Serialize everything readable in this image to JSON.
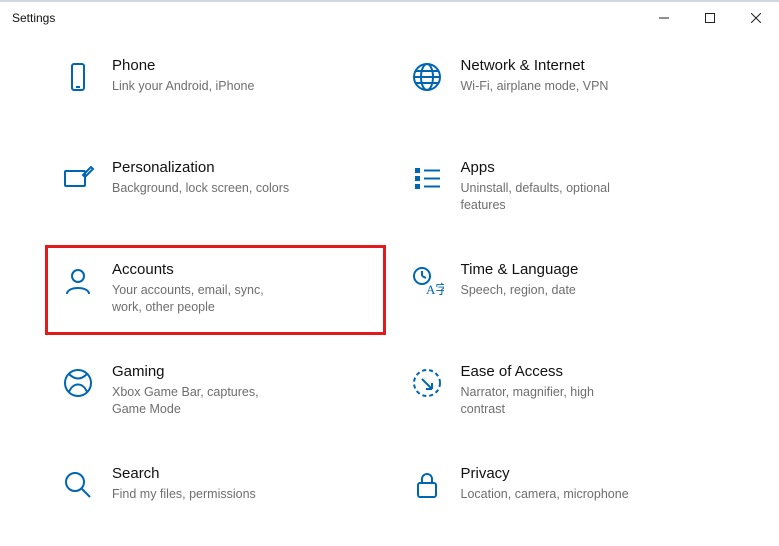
{
  "window": {
    "title": "Settings"
  },
  "highlightIndex": 4,
  "tiles": [
    {
      "title": "Phone",
      "desc": "Link your Android, iPhone"
    },
    {
      "title": "Network & Internet",
      "desc": "Wi-Fi, airplane mode, VPN"
    },
    {
      "title": "Personalization",
      "desc": "Background, lock screen, colors"
    },
    {
      "title": "Apps",
      "desc": "Uninstall, defaults, optional features"
    },
    {
      "title": "Accounts",
      "desc": "Your accounts, email, sync, work, other people"
    },
    {
      "title": "Time & Language",
      "desc": "Speech, region, date"
    },
    {
      "title": "Gaming",
      "desc": "Xbox Game Bar, captures, Game Mode"
    },
    {
      "title": "Ease of Access",
      "desc": "Narrator, magnifier, high contrast"
    },
    {
      "title": "Search",
      "desc": "Find my files, permissions"
    },
    {
      "title": "Privacy",
      "desc": "Location, camera, microphone"
    }
  ]
}
